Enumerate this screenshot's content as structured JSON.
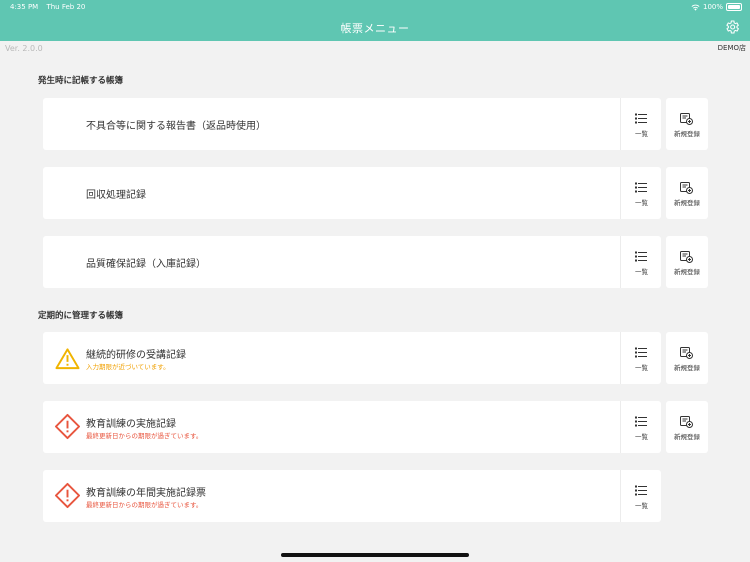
{
  "status_bar": {
    "time": "4:35 PM",
    "date": "Thu Feb 20",
    "battery": "100%"
  },
  "nav": {
    "title": "帳票メニュー",
    "settings_icon": "gear-icon"
  },
  "version": "Ver. 2.0.0",
  "shop": "DEMO店",
  "colors": {
    "accent": "#5fc6b2",
    "warning": "#f0b400",
    "danger": "#e8553e"
  },
  "sections": [
    {
      "title": "発生時に記帳する帳簿",
      "items": [
        {
          "name": "不具合等に関する報告書（返品時使用）",
          "list_label": "一覧",
          "new_label": "新規登録"
        },
        {
          "name": "回収処理記録",
          "list_label": "一覧",
          "new_label": "新規登録"
        },
        {
          "name": "品質確保記録（入庫記録）",
          "list_label": "一覧",
          "new_label": "新規登録"
        }
      ]
    },
    {
      "title": "定期的に管理する帳簿",
      "items": [
        {
          "name": "継続的研修の受講記録",
          "sub": "入力期限が近づいています。",
          "icon": "warning-icon",
          "list_label": "一覧",
          "new_label": "新規登録"
        },
        {
          "name": "教育訓練の実施記録",
          "sub": "最終更新日からの期限が過ぎています。",
          "icon": "alert-diamond-icon",
          "list_label": "一覧",
          "new_label": "新規登録"
        },
        {
          "name": "教育訓練の年間実施記録票",
          "sub": "最終更新日からの期限が過ぎています。",
          "icon": "alert-diamond-icon",
          "list_label": "一覧"
        }
      ]
    }
  ]
}
